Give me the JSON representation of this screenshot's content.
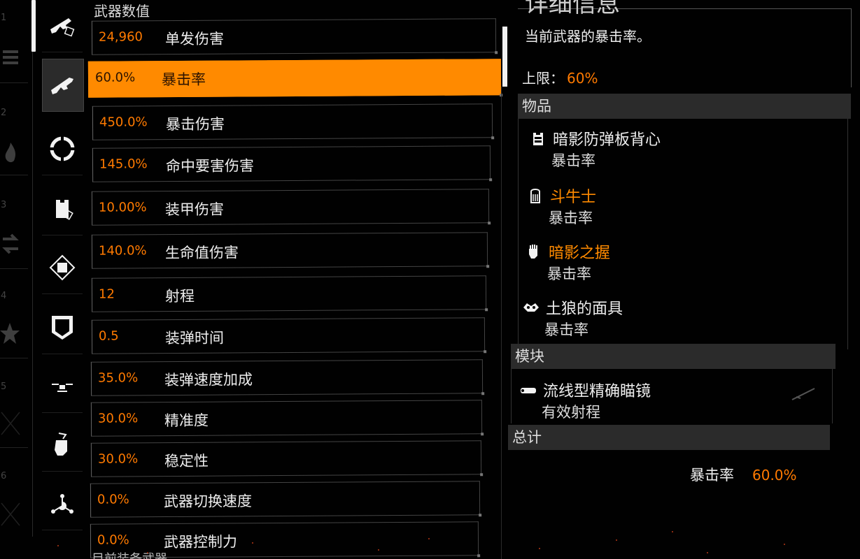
{
  "left_strip": {
    "numbers": [
      "1",
      "2",
      "3",
      "4",
      "5",
      "6"
    ]
  },
  "stats": {
    "section_title": "武器数值",
    "rows": [
      {
        "value": "24,960",
        "label": "单发伤害"
      },
      {
        "value": "60.0%",
        "label": "暴击率",
        "active": true
      },
      {
        "value": "450.0%",
        "label": "暴击伤害"
      },
      {
        "value": "145.0%",
        "label": "命中要害伤害"
      },
      {
        "value": "10.00%",
        "label": "装甲伤害"
      },
      {
        "value": "140.0%",
        "label": "生命值伤害"
      },
      {
        "value": "12",
        "label": "射程"
      },
      {
        "value": "0.5",
        "label": "装弹时间"
      },
      {
        "value": "35.0%",
        "label": "装弹速度加成"
      },
      {
        "value": "30.0%",
        "label": "精准度"
      },
      {
        "value": "30.0%",
        "label": "稳定性"
      },
      {
        "value": "0.0%",
        "label": "武器切换速度"
      },
      {
        "value": "0.0%",
        "label": "武器控制力"
      }
    ],
    "bottom_peek": "目前装备武器"
  },
  "detail": {
    "title": "详细信息",
    "description": "当前武器的暴击率。",
    "limit_label": "上限：",
    "limit_value": "60%",
    "items_header": "物品",
    "items": [
      {
        "name": "暗影防弹板背心",
        "stat": "暴击率",
        "highlight": false,
        "icon": "vest-icon"
      },
      {
        "name": "斗牛士",
        "stat": "暴击率",
        "highlight": true,
        "icon": "backpack-icon"
      },
      {
        "name": "暗影之握",
        "stat": "暴击率",
        "highlight": true,
        "icon": "glove-icon"
      },
      {
        "name": "土狼的面具",
        "stat": "暴击率",
        "highlight": false,
        "icon": "mask-icon"
      }
    ],
    "mods_header": "模块",
    "mods": [
      {
        "name": "流线型精确瞄镜",
        "stat": "有效射程",
        "icon": "scope-icon"
      }
    ],
    "total_header": "总计",
    "total_label": "暴击率",
    "total_value": "60.0%"
  },
  "colors": {
    "accent": "#ff8a00",
    "value_orange": "#ff7a00",
    "panel_header": "#2b2b2b"
  }
}
